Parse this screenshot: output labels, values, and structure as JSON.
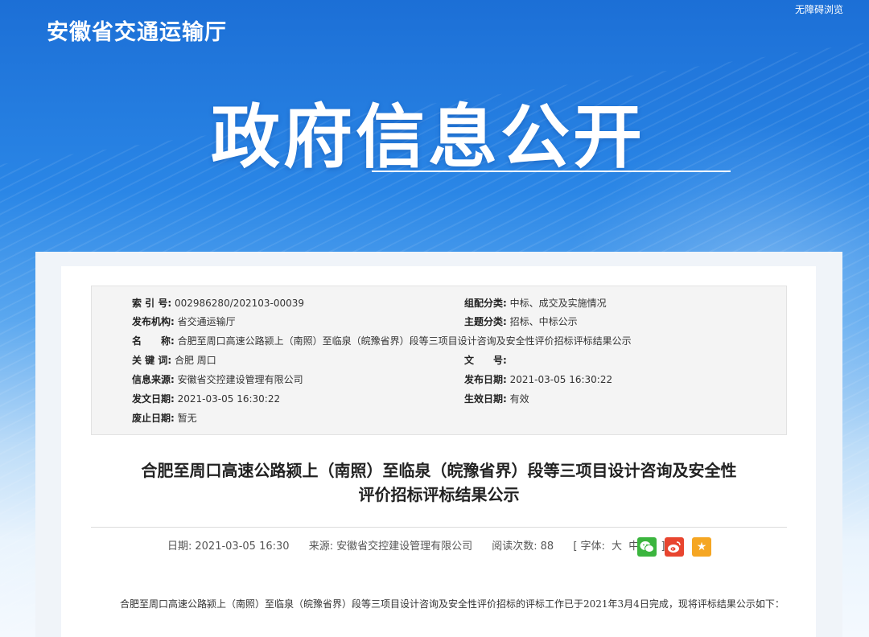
{
  "header": {
    "site_title": "安徽省交通运输厅",
    "accessibility_link": "无障碍浏览",
    "hero_title": "政府信息公开"
  },
  "meta": {
    "index_no_label": "索 引 号:",
    "index_no": "002986280/202103-00039",
    "category_label": "组配分类:",
    "category": "中标、成交及实施情况",
    "publisher_label": "发布机构:",
    "publisher": "省交通运输厅",
    "topic_label": "主题分类:",
    "topic": "招标、中标公示",
    "name_label": "名　　称:",
    "name": "合肥至周口高速公路颍上（南照）至临泉（皖豫省界）段等三项目设计咨询及安全性评价招标评标结果公示",
    "keywords_label": "关 键 词:",
    "keywords": "合肥 周口",
    "doc_no_label": "文　　号:",
    "doc_no": "",
    "source_label": "信息来源:",
    "source": "安徽省交控建设管理有限公司",
    "publish_date_label": "发布日期:",
    "publish_date": "2021-03-05 16:30:22",
    "issue_date_label": "发文日期:",
    "issue_date": "2021-03-05 16:30:22",
    "effective_label": "生效日期:",
    "effective": "有效",
    "expiry_label": "废止日期:",
    "expiry": "暂无"
  },
  "article": {
    "title_line1": "合肥至周口高速公路颍上（南照）至临泉（皖豫省界）段等三项目设计咨询及安全性",
    "title_line2": "评价招标评标结果公示",
    "date_label": "日期:",
    "date": "2021-03-05 16:30",
    "source_label": "来源:",
    "source": "安徽省交控建设管理有限公司",
    "reads_label": "阅读次数:",
    "reads": "88",
    "font_open": "[ 字体:",
    "font_large": "大",
    "font_medium": "中",
    "font_small": "小",
    "font_close": "]",
    "body": "合肥至周口高速公路颍上（南照）至临泉（皖豫省界）段等三项目设计咨询及安全性评价招标的评标工作已于2021年3月4日完成，现将评标结果公示如下："
  },
  "share": {
    "wechat_icon": "wechat-icon",
    "weibo_icon": "weibo-icon",
    "favorite_icon": "star-icon"
  }
}
